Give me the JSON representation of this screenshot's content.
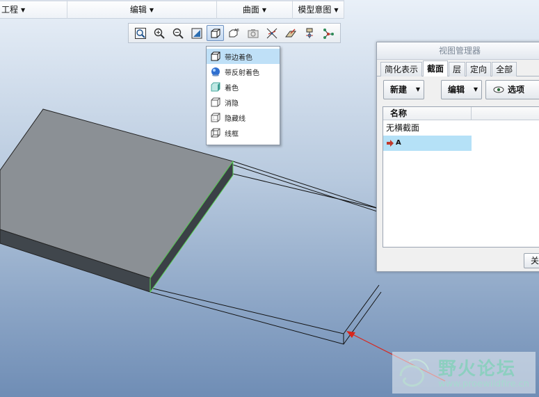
{
  "ribbon": {
    "groups": [
      {
        "label": "工程"
      },
      {
        "label": "编辑"
      },
      {
        "label": "曲面"
      },
      {
        "label": "模型意图"
      }
    ]
  },
  "view_toolbar": {
    "buttons": [
      {
        "icon": "zoom-fit-icon"
      },
      {
        "icon": "zoom-in-icon"
      },
      {
        "icon": "zoom-out-icon"
      },
      {
        "icon": "repaint-icon"
      },
      {
        "icon": "display-style-icon"
      },
      {
        "icon": "saved-views-icon"
      },
      {
        "icon": "camera-icon"
      },
      {
        "icon": "datum-display-icon"
      },
      {
        "icon": "annotation-display-icon"
      },
      {
        "icon": "spin-center-icon"
      },
      {
        "icon": "network-icon"
      }
    ]
  },
  "display_menu": {
    "items": [
      {
        "label": "带边着色"
      },
      {
        "label": "带反射着色"
      },
      {
        "label": "着色"
      },
      {
        "label": "消隐"
      },
      {
        "label": "隐藏线"
      },
      {
        "label": "线框"
      }
    ],
    "highlighted_index": 0
  },
  "view_manager": {
    "title": "视图管理器",
    "tabs": [
      {
        "label": "简化表示"
      },
      {
        "label": "截面"
      },
      {
        "label": "层"
      },
      {
        "label": "定向"
      },
      {
        "label": "全部"
      }
    ],
    "selected_tab": 1,
    "buttons": {
      "new": "新建",
      "edit": "编辑",
      "options": "选项"
    },
    "list_header": "名称",
    "rows": [
      {
        "label": "无横截面"
      },
      {
        "label": "A"
      }
    ],
    "close": "关"
  },
  "watermark": {
    "title": "野火论坛",
    "url": "www.proewildfire.cn"
  },
  "colors": {
    "model_top": "#8b9095",
    "model_edge": "#5a8a3a",
    "arrow": "#d9261c",
    "menu_highlight": "#bfe0f7",
    "list_highlight": "#b5e1f7"
  }
}
